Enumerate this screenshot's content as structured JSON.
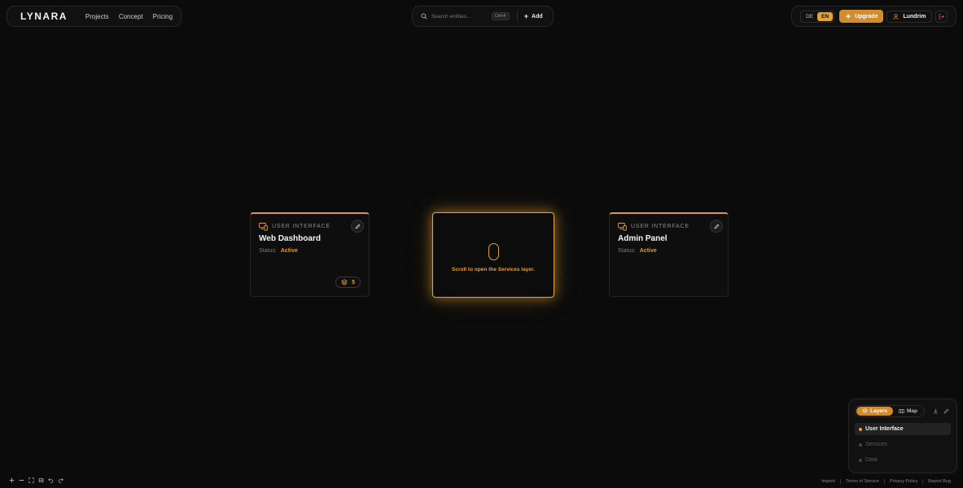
{
  "brand": {
    "name": "LYNARA"
  },
  "nav": {
    "items": [
      "Projects",
      "Concept",
      "Pricing"
    ]
  },
  "search": {
    "placeholder": "Search entities...",
    "shortcut": "Ctrl+F",
    "add_label": "Add"
  },
  "header_right": {
    "lang_de": "DE",
    "lang_en": "EN",
    "active_lang": "EN",
    "upgrade_label": "Upgrade",
    "user_name": "Lundrim"
  },
  "cards": [
    {
      "type": "USER INTERFACE",
      "title": "Web Dashboard",
      "status_label": "Status:",
      "status_value": "Active",
      "count": "5"
    },
    {
      "type": "USER INTERFACE",
      "title": "Admin Panel",
      "status_label": "Status:",
      "status_value": "Active"
    }
  ],
  "center_card": {
    "hint": "Scroll to open the Services layer."
  },
  "layers_panel": {
    "tab_layers": "Layers",
    "tab_map": "Map",
    "active_tab": "Layers",
    "items": [
      "User Interface",
      "Services",
      "Data"
    ],
    "active_item": "User Interface"
  },
  "footer": {
    "links": [
      "Imprint",
      "Terms of Service",
      "Privacy Policy",
      "Report Bug"
    ]
  },
  "colors": {
    "accent": "#e3a03c",
    "upgrade": "#d18c2e",
    "background": "#0b0b0b"
  }
}
